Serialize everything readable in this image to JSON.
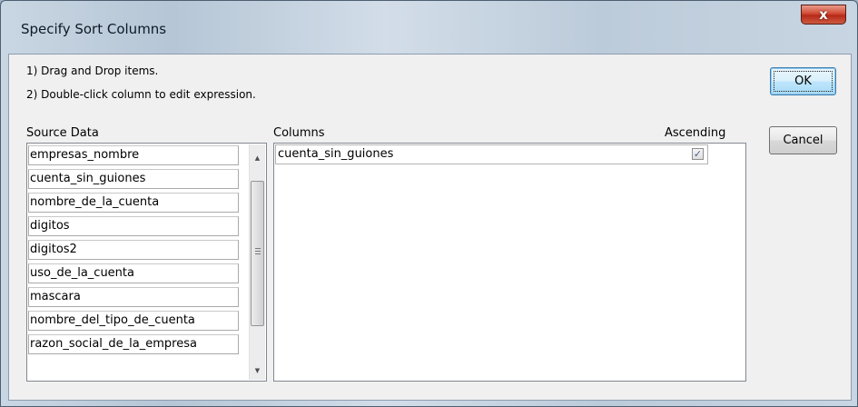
{
  "window": {
    "title": "Specify Sort Columns",
    "close_glyph": "x"
  },
  "instructions": [
    "1) Drag and Drop items.",
    "2) Double-click column to edit expression."
  ],
  "source": {
    "label": "Source Data",
    "items": [
      "empresas_nombre",
      "cuenta_sin_guiones",
      "nombre_de_la_cuenta",
      "digitos",
      "digitos2",
      "uso_de_la_cuenta",
      "mascara",
      "nombre_del_tipo_de_cuenta",
      "razon_social_de_la_empresa"
    ]
  },
  "columns": {
    "label": "Columns",
    "ascending_label": "Ascending",
    "rows": [
      {
        "name": "cuenta_sin_guiones",
        "ascending": true,
        "check_glyph": "✓"
      }
    ]
  },
  "buttons": {
    "ok": "OK",
    "cancel": "Cancel"
  },
  "icons": {
    "scroll_up": "up-arrow-icon",
    "scroll_down": "down-arrow-icon",
    "close": "close-icon"
  }
}
